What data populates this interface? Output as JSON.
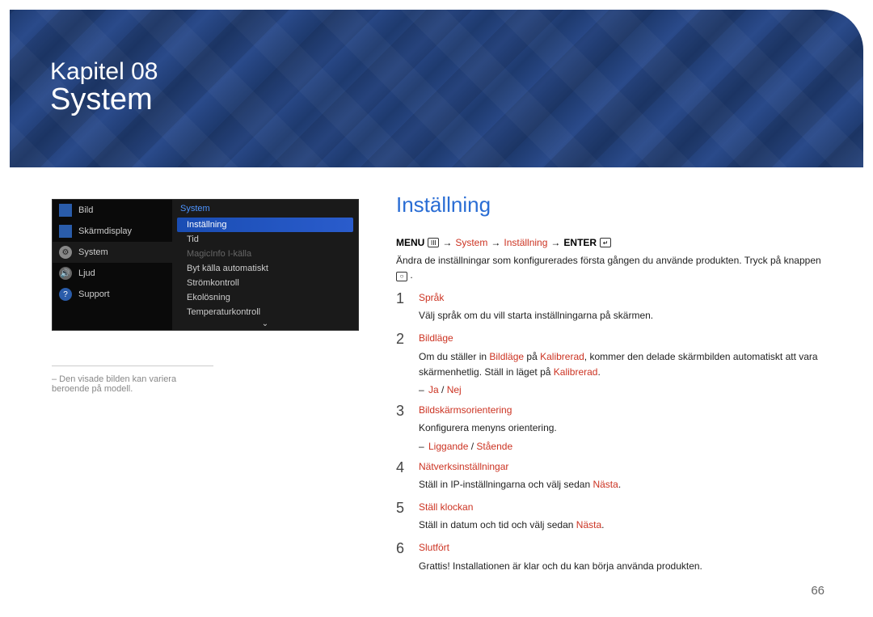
{
  "hero": {
    "chapter": "Kapitel 08",
    "title": "System"
  },
  "tv_menu": {
    "sidebar": [
      {
        "label": "Bild",
        "icon": "box"
      },
      {
        "label": "Skärmdisplay",
        "icon": "box2"
      },
      {
        "label": "System",
        "icon": "gear",
        "active": true
      },
      {
        "label": "Ljud",
        "icon": "sound"
      },
      {
        "label": "Support",
        "icon": "help"
      }
    ],
    "panel_header": "System",
    "panel_items": [
      {
        "label": "Inställning",
        "selected": true
      },
      {
        "label": "Tid"
      },
      {
        "label": "MagicInfo I-källa",
        "disabled": true
      },
      {
        "label": "Byt källa automatiskt"
      },
      {
        "label": "Strömkontroll"
      },
      {
        "label": "Ekolösning"
      },
      {
        "label": "Temperaturkontroll"
      }
    ]
  },
  "caption": "– Den visade bilden kan variera beroende på modell.",
  "content": {
    "title": "Inställning",
    "breadcrumb": {
      "menu": "MENU",
      "system": "System",
      "setup": "Inställning",
      "enter": "ENTER"
    },
    "intro_a": "Ändra de inställningar som konfigurerades första gången du använde produkten. Tryck på knappen ",
    "intro_b": ".",
    "steps": [
      {
        "num": "1",
        "title": "Språk",
        "desc": "Välj språk om du vill starta inställningarna på skärmen."
      },
      {
        "num": "2",
        "title": "Bildläge",
        "desc_a": "Om du ställer in ",
        "desc_b": " på ",
        "desc_c": ", kommer den delade skärmbilden automatiskt att vara skärmenhetlig. Ställ in läget på ",
        "desc_d": ".",
        "red1": "Bildläge",
        "red2": "Kalibrerad",
        "red3": "Kalibrerad",
        "opts": {
          "a": "Ja",
          "b": "Nej",
          "sep": " / "
        }
      },
      {
        "num": "3",
        "title": "Bildskärmsorientering",
        "desc": "Konfigurera menyns orientering.",
        "opts": {
          "a": "Liggande",
          "b": "Stående",
          "sep": " / "
        }
      },
      {
        "num": "4",
        "title": "Nätverksinställningar",
        "desc_a": "Ställ in IP-inställningarna och välj sedan ",
        "red1": "Nästa",
        "desc_b": "."
      },
      {
        "num": "5",
        "title": "Ställ klockan",
        "desc_a": "Ställ in datum och tid och välj sedan ",
        "red1": "Nästa",
        "desc_b": "."
      },
      {
        "num": "6",
        "title": "Slutfört",
        "desc": "Grattis! Installationen är klar och du kan börja använda produkten."
      }
    ]
  },
  "page_num": "66"
}
